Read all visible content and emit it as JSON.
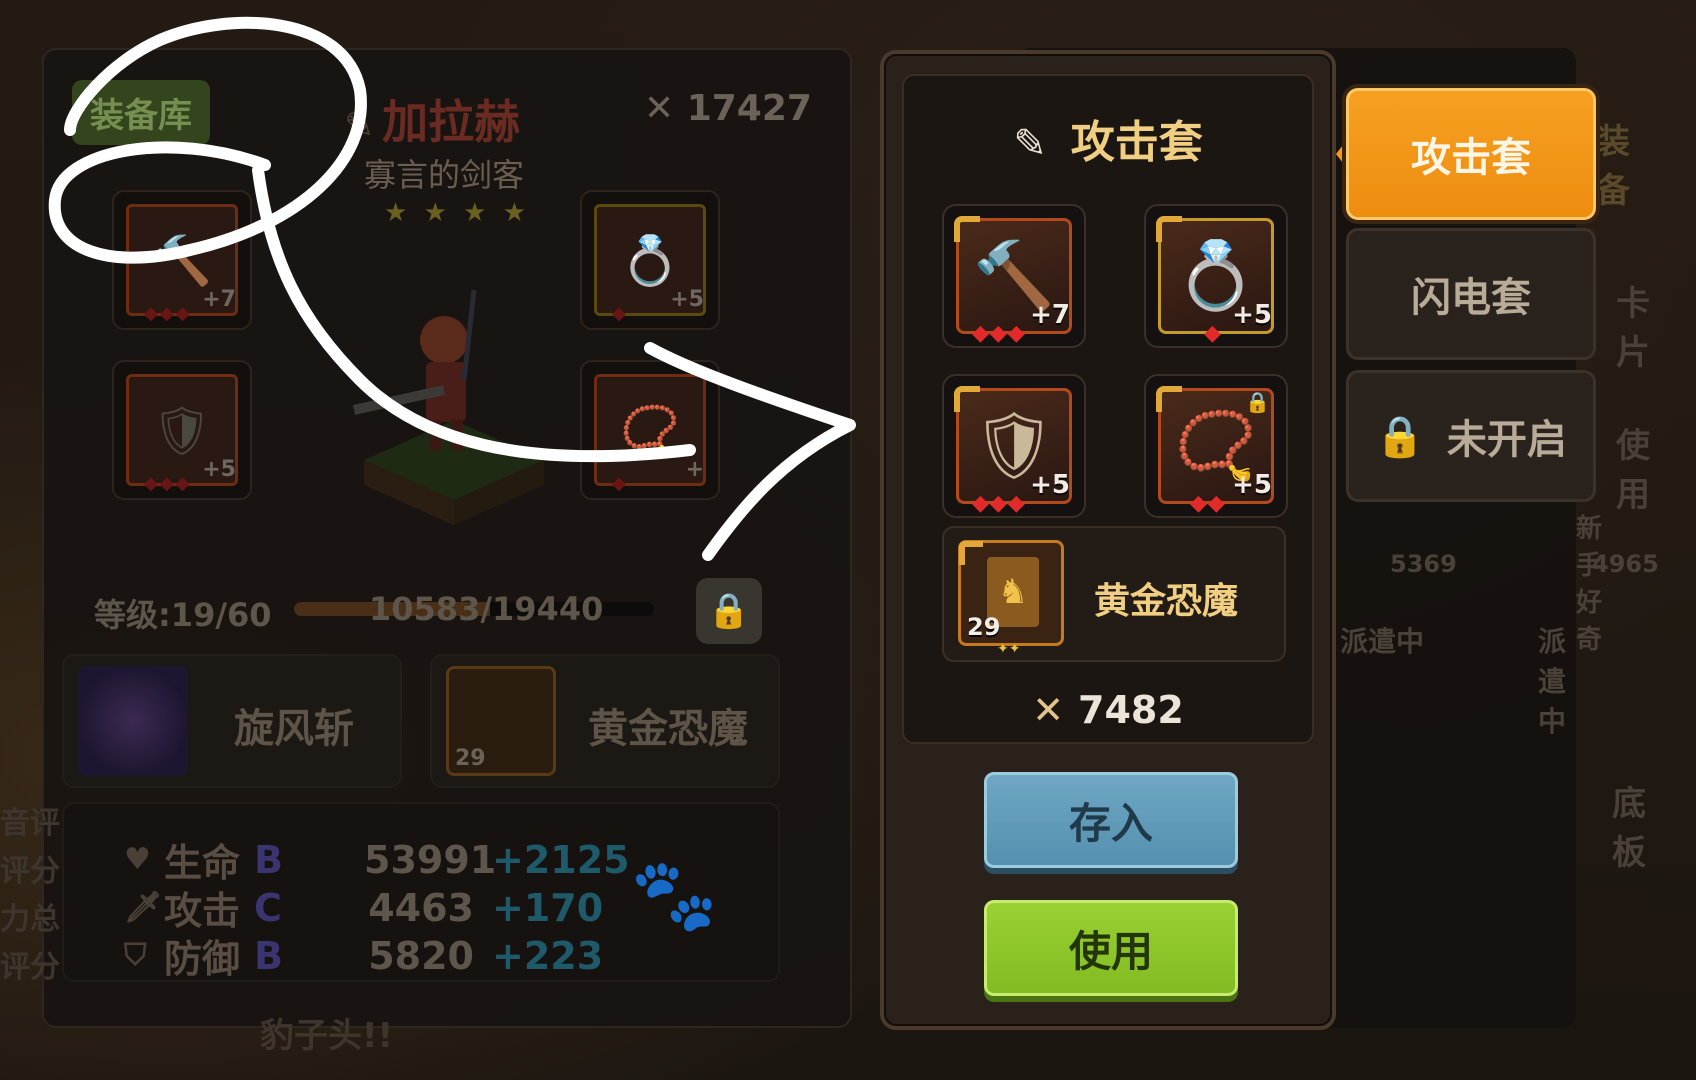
{
  "left_panel": {
    "library_tag": "装备库",
    "hero_name": "加拉赫",
    "hero_title": "寡言的剑客",
    "stars": "★ ★ ★ ★",
    "power": "17427",
    "slots": [
      {
        "level": "+7",
        "gems": "◆◆◆"
      },
      {
        "level": "+5",
        "gems": "◆"
      },
      {
        "level": "+5",
        "gems": "◆◆◆"
      },
      {
        "level": "+",
        "gems": "◆"
      }
    ],
    "level_label": "等级:19/60",
    "exp_text": "10583/19440",
    "exp_fraction": 0.544,
    "skill_name": "旋风斩",
    "card_name": "黄金恐魔",
    "card_number": "29",
    "stats": [
      {
        "name": "生命",
        "grade": "B",
        "value": "53991",
        "bonus": "+2125"
      },
      {
        "name": "攻击",
        "grade": "C",
        "value": "4463",
        "bonus": "+170"
      },
      {
        "name": "防御",
        "grade": "B",
        "value": "5820",
        "bonus": "+223"
      }
    ]
  },
  "set_panel": {
    "title": "攻击套",
    "equipment": [
      {
        "name": "hammer",
        "level": "+7",
        "gems": "◆◆◆",
        "locked": false
      },
      {
        "name": "ring",
        "level": "+5",
        "gems": "◆",
        "locked": false
      },
      {
        "name": "armor",
        "level": "+5",
        "gems": "◆◆◆",
        "locked": false
      },
      {
        "name": "necklace",
        "level": "+5",
        "gems": "◆◆",
        "locked": true
      }
    ],
    "card": {
      "name": "黄金恐魔",
      "number": "29",
      "stars": "✦✦"
    },
    "power": "7482",
    "store_button": "存入",
    "use_button": "使用"
  },
  "tabs": [
    {
      "label": "攻击套",
      "active": true
    },
    {
      "label": "闪电套",
      "active": false
    },
    {
      "label": "未开启",
      "active": false,
      "locked": true
    }
  ],
  "background_ghost_text": {
    "equip_tab": "装备",
    "card_tab": "卡片",
    "use_tab": "使用",
    "newbie": "新手好奇",
    "newbie_score": "4965",
    "other_score": "5369",
    "in_dispatch_1": "派遣中",
    "in_dispatch_2": "派遣中",
    "floor": "底板",
    "left_clip": [
      "音评",
      "评分",
      "力总",
      "评分"
    ],
    "bottom_ghost": "豹子头!!"
  },
  "colors": {
    "accent_orange": "#f39a18",
    "title_gold": "#f1cf82",
    "store_blue": "#6fa7c4",
    "use_green": "#9ad133",
    "gem_red": "#e22a2a"
  }
}
